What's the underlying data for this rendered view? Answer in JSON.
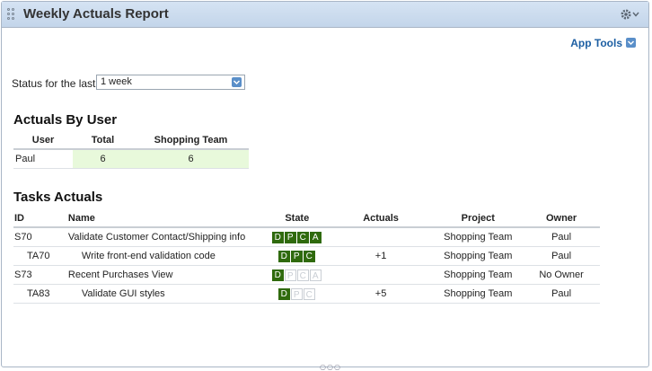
{
  "window": {
    "title": "Weekly Actuals Report"
  },
  "toolbar": {
    "app_tools_label": "App Tools"
  },
  "status_filter": {
    "label": "Status for the last",
    "selected": "1 week"
  },
  "actuals_by_user": {
    "heading": "Actuals By User",
    "columns": [
      "User",
      "Total",
      "Shopping Team"
    ],
    "rows": [
      {
        "user": "Paul",
        "total": "6",
        "shopping_team": "6"
      }
    ]
  },
  "tasks_actuals": {
    "heading": "Tasks Actuals",
    "columns": [
      "ID",
      "Name",
      "State",
      "Actuals",
      "Project",
      "Owner"
    ],
    "rows": [
      {
        "id": "S70",
        "name": "Validate Customer Contact/Shipping info",
        "state": [
          "D",
          "P",
          "C",
          "A"
        ],
        "state_active": [
          true,
          true,
          true,
          true
        ],
        "actuals": "",
        "project": "Shopping Team",
        "owner": "Paul"
      },
      {
        "id": "TA70",
        "name": "Write front-end validation code",
        "state": [
          "D",
          "P",
          "C"
        ],
        "state_active": [
          true,
          true,
          true
        ],
        "actuals": "+1",
        "project": "Shopping Team",
        "owner": "Paul"
      },
      {
        "id": "S73",
        "name": "Recent Purchases View",
        "state": [
          "D",
          "P",
          "C",
          "A"
        ],
        "state_active": [
          true,
          false,
          false,
          false
        ],
        "actuals": "",
        "project": "Shopping Team",
        "owner": "No Owner"
      },
      {
        "id": "TA83",
        "name": "Validate GUI styles",
        "state": [
          "D",
          "P",
          "C"
        ],
        "state_active": [
          true,
          false,
          false
        ],
        "actuals": "+5",
        "project": "Shopping Team",
        "owner": "Paul"
      }
    ]
  },
  "icons": {
    "grip": "drag-grip-icon",
    "gear": "gear-icon",
    "chevron": "chevron-down-icon",
    "resize": "resize-dots-icon"
  },
  "colors": {
    "titlebar": "#c3d5ea",
    "link": "#1d5fa3",
    "state_active": "#2f6a0d",
    "highlight": "#e8f9db"
  }
}
